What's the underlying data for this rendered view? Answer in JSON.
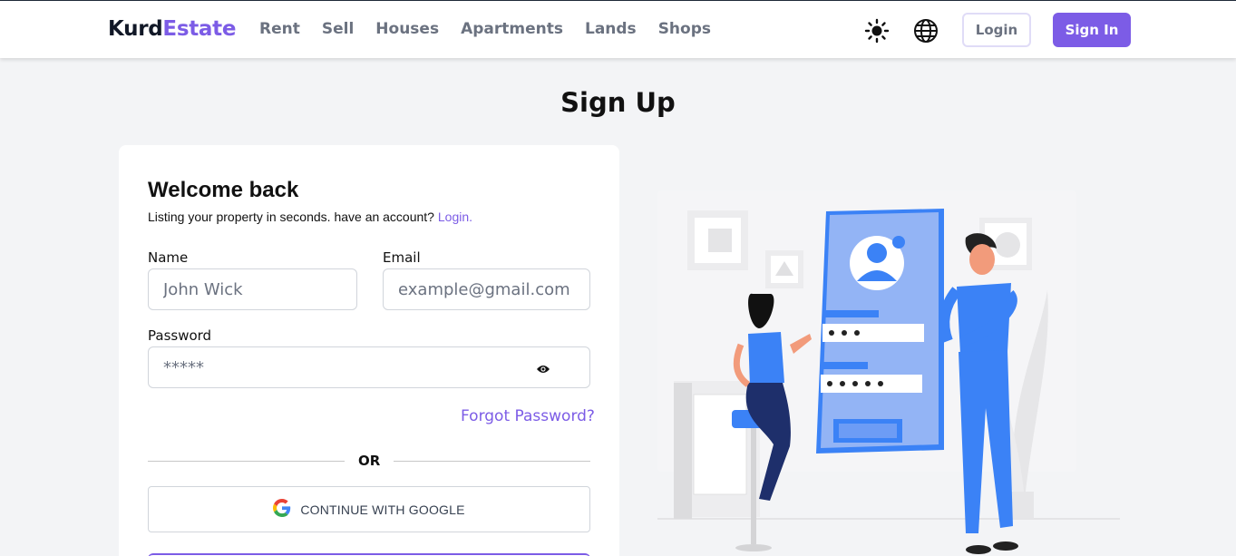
{
  "brand": {
    "part1": "Kurd",
    "part2": "Estate",
    "accent": "#7c5ce6"
  },
  "nav": {
    "links": [
      "Rent",
      "Sell",
      "Houses",
      "Apartments",
      "Lands",
      "Shops"
    ]
  },
  "header": {
    "theme_icon": "sun-icon",
    "language_icon": "globe-icon",
    "login_label": "Login",
    "signin_label": "Sign In"
  },
  "page": {
    "title": "Sign Up"
  },
  "form": {
    "heading": "Welcome back",
    "subtitle": "Listing your property in seconds. have an account?",
    "subtitle_link": "Login.",
    "name_label": "Name",
    "name_placeholder": "John Wick",
    "email_label": "Email",
    "email_placeholder": "example@gmail.com",
    "password_label": "Password",
    "password_placeholder": "*****",
    "forgot_label": "Forgot Password?",
    "or_label": "OR",
    "google_label": "CONTINUE WITH GOOGLE"
  }
}
